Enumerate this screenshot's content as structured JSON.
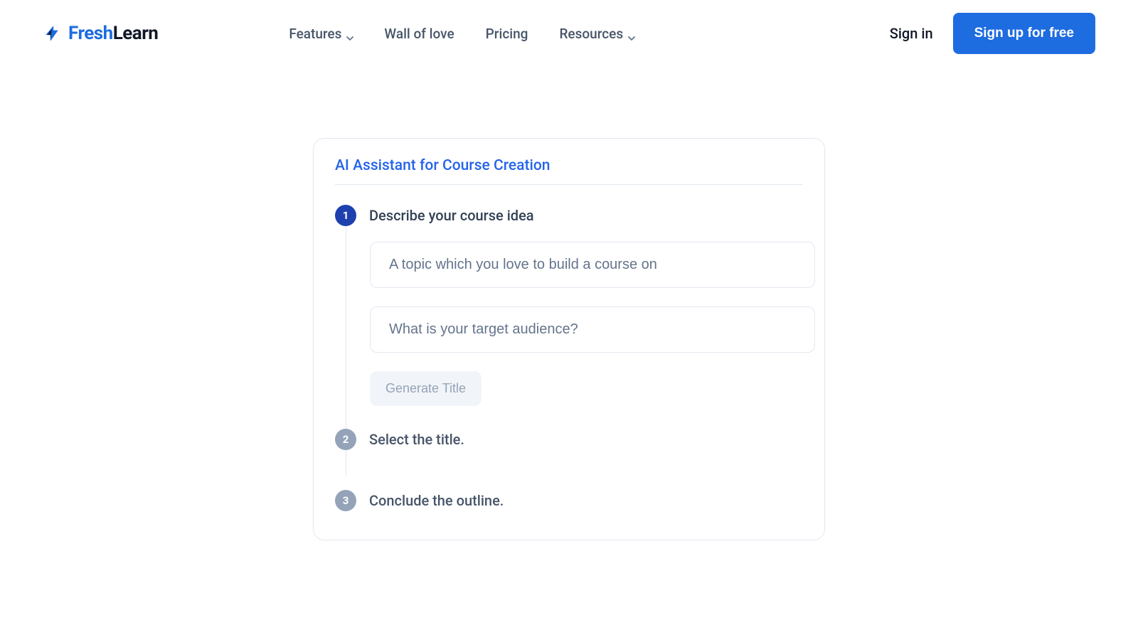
{
  "brand": {
    "fresh": "Fresh",
    "learn": "Learn"
  },
  "nav": {
    "features": "Features",
    "wall": "Wall of love",
    "pricing": "Pricing",
    "resources": "Resources"
  },
  "auth": {
    "signin": "Sign in",
    "signup": "Sign up for free"
  },
  "card": {
    "title": "AI Assistant for Course Creation",
    "step1": {
      "num": "1",
      "label": "Describe your course idea",
      "topic_placeholder": "A topic which you love to build a course on",
      "audience_placeholder": "What is your target audience?",
      "generate_label": "Generate Title"
    },
    "step2": {
      "num": "2",
      "label": "Select the title."
    },
    "step3": {
      "num": "3",
      "label": "Conclude the outline."
    }
  }
}
